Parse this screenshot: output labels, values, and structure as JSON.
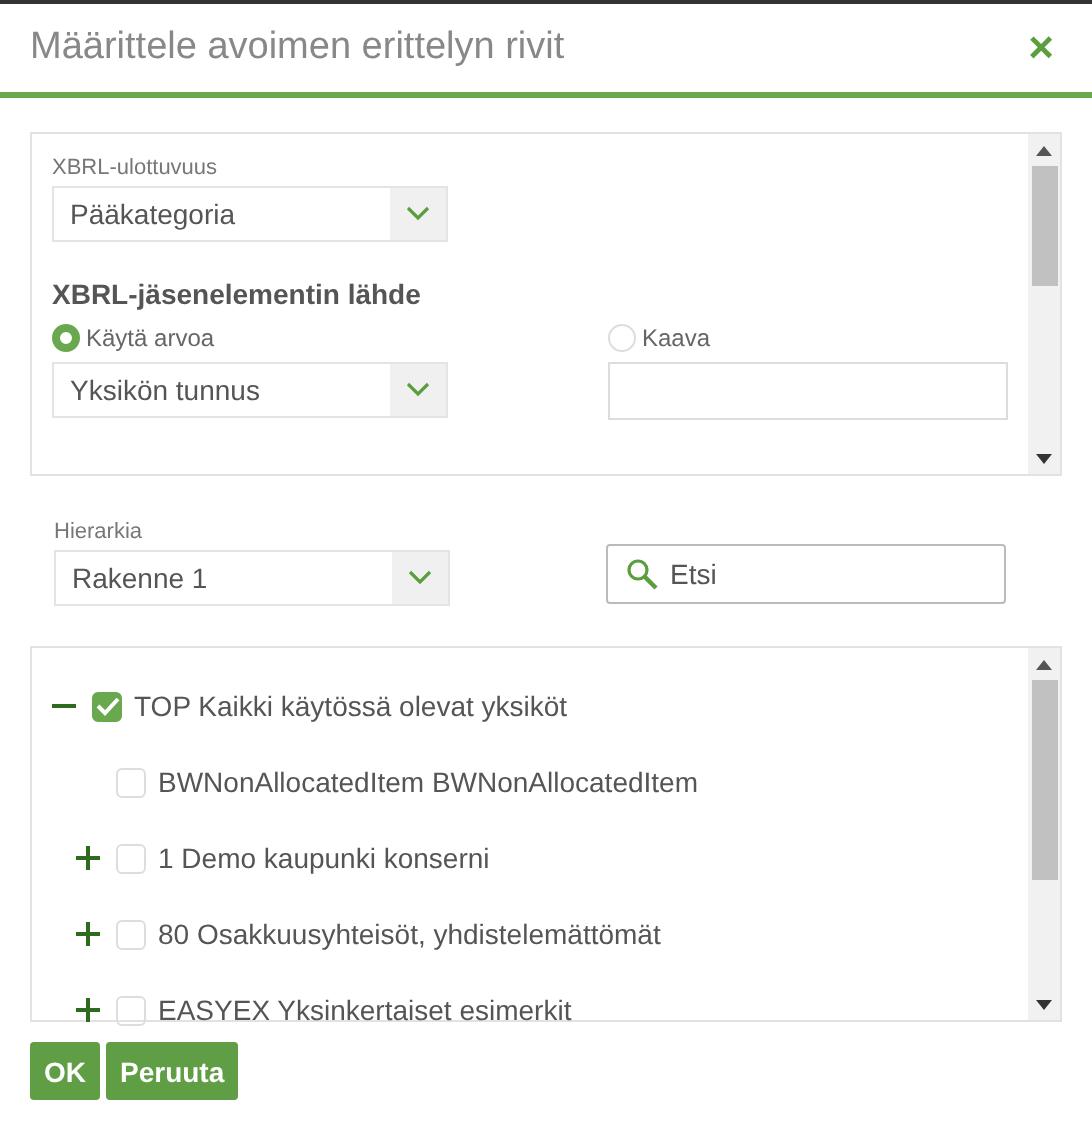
{
  "dialog": {
    "title": "Määrittele avoimen erittelyn rivit",
    "close": "×"
  },
  "source_panel": {
    "dimension_label": "XBRL-ulottuvuus",
    "dimension_value": "Pääkategoria",
    "section_title": "XBRL-jäsenelementin lähde",
    "options": [
      {
        "label": "Käytä arvoa",
        "selected": true,
        "kind": "select",
        "value": "Yksikön tunnus"
      },
      {
        "label": "Kaava",
        "selected": false,
        "kind": "text"
      }
    ]
  },
  "hierarchy": {
    "label": "Hierarkia",
    "value": "Rakenne 1"
  },
  "search": {
    "placeholder": "Etsi"
  },
  "tree": [
    {
      "label": "TOP Kaikki käytössä olevat yksiköt",
      "checked": true,
      "kind": "branch",
      "expanded": true,
      "children": [
        {
          "label": "BWNonAllocatedItem BWNonAllocatedItem",
          "checked": false,
          "kind": "leaf"
        },
        {
          "label": "1 Demo kaupunki konserni",
          "checked": false,
          "kind": "branch",
          "expanded": false
        },
        {
          "label": "80 Osakkuusyhteisöt, yhdistelemättömät",
          "checked": false,
          "kind": "branch",
          "expanded": false
        },
        {
          "label": "EASYEX Yksinkertaiset esimerkit",
          "checked": false,
          "kind": "branch",
          "expanded": false
        }
      ]
    }
  ],
  "buttons": [
    "OK",
    "Peruuta"
  ]
}
